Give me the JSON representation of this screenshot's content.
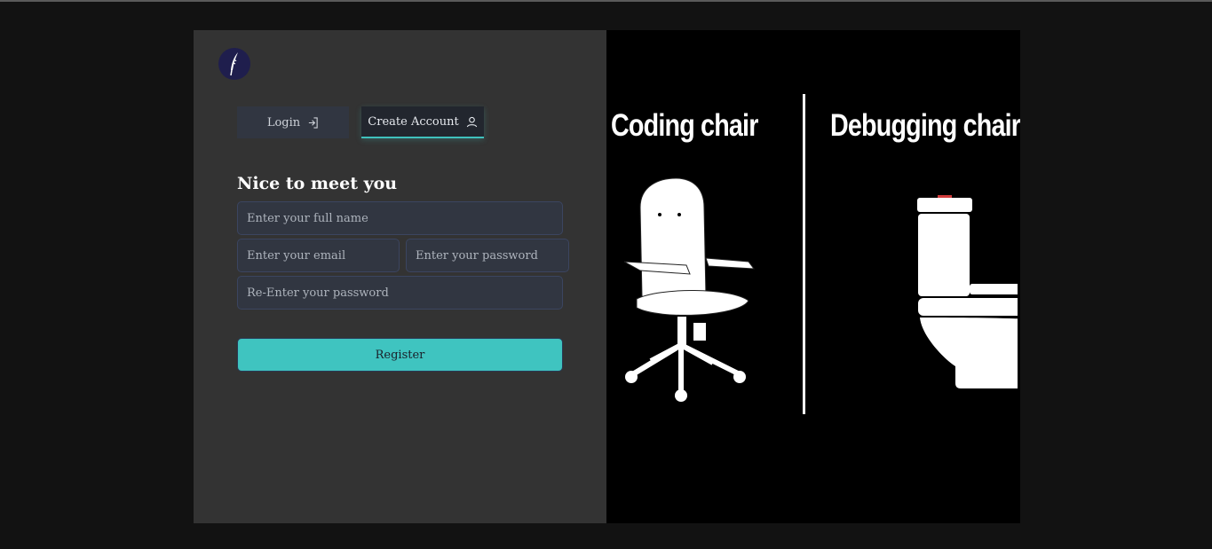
{
  "app": {
    "logo_icon": "quill-pen-icon",
    "accent_color": "#3fc4c0"
  },
  "tabs": {
    "login": {
      "label": "Login",
      "icon": "login-arrow-icon"
    },
    "create": {
      "label": "Create Account",
      "icon": "user-icon"
    }
  },
  "form": {
    "heading": "Nice to meet you",
    "full_name": {
      "placeholder": "Enter your full name",
      "value": ""
    },
    "email": {
      "placeholder": "Enter your email",
      "value": ""
    },
    "password": {
      "placeholder": "Enter your password",
      "value": ""
    },
    "repassword": {
      "placeholder": "Re-Enter your password",
      "value": ""
    },
    "submit_label": "Register"
  },
  "meme": {
    "left_caption": "Coding chair",
    "right_caption": "Debugging chair",
    "left_image": "office-chair-icon",
    "right_image": "toilet-icon"
  }
}
